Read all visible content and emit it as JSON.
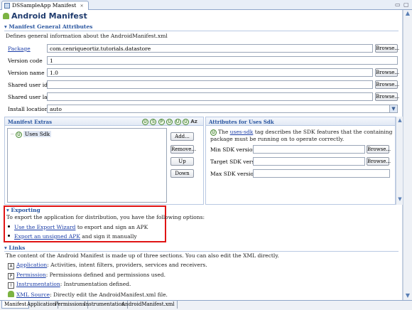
{
  "editor_tab": {
    "label": "DSSampleApp Manifest",
    "close": "✕"
  },
  "window": {
    "minimize": "▭",
    "maximize": "▢"
  },
  "page": {
    "title": "Android Manifest"
  },
  "general": {
    "header": "Manifest General Attributes",
    "description": "Defines general information about the AndroidManifest.xml",
    "fields": {
      "package_label": "Package",
      "package_value": "com.cenriqueortiz.tutorials.datastore",
      "version_code_label": "Version code",
      "version_code_value": "1",
      "version_name_label": "Version name",
      "version_name_value": "1.0",
      "shared_user_id_label": "Shared user id",
      "shared_user_id_value": "",
      "shared_user_label_label": "Shared user label",
      "shared_user_label_value": "",
      "install_location_label": "Install location",
      "install_location_value": "auto"
    },
    "browse": "Browse..."
  },
  "extras": {
    "header": "Manifest Extras",
    "icons": [
      "U",
      "S",
      "P",
      "U",
      "U",
      "U"
    ],
    "sort": "Az",
    "tree_item": "Uses Sdk",
    "buttons": {
      "add": "Add...",
      "remove": "Remove...",
      "up": "Up",
      "down": "Down"
    }
  },
  "attributes": {
    "header": "Attributes for Uses Sdk",
    "desc_pre": "The ",
    "desc_link": "uses-sdk",
    "desc_post": " tag describes the SDK features that the containing package must be running on to operate correctly.",
    "min_label": "Min SDK version",
    "min_value": "",
    "target_label": "Target SDK version",
    "target_value": "",
    "max_label": "Max SDK version",
    "max_value": "",
    "browse": "Browse..."
  },
  "exporting": {
    "header": "Exporting",
    "description": "To export the application for distribution, you have the following options:",
    "item1_link": "Use the Export Wizard",
    "item1_text": " to export and sign an APK",
    "item2_link": "Export an unsigned APK",
    "item2_text": " and sign it manually"
  },
  "links": {
    "header": "Links",
    "description": "The content of the Android Manifest is made up of three sections. You can also edit the XML directly.",
    "items": [
      {
        "icon": "A",
        "link": "Application",
        "text": ": Activities, intent filters, providers, services and receivers."
      },
      {
        "icon": "P",
        "link": "Permission",
        "text": ": Permissions defined and permissions used."
      },
      {
        "icon": "I",
        "link": "Instrumentation",
        "text": ": Instrumentation defined."
      },
      {
        "icon": "",
        "link": "XML Source",
        "text": ": Directly edit the AndroidManifest.xml file."
      }
    ]
  },
  "bottom_tabs": [
    "Manifest",
    "Application",
    "Permissions",
    "Instrumentation",
    "AndroidManifest.xml"
  ],
  "colors": {
    "accent": "#2a56a0",
    "highlight_box": "#e01414",
    "link": "#1b3da8"
  }
}
